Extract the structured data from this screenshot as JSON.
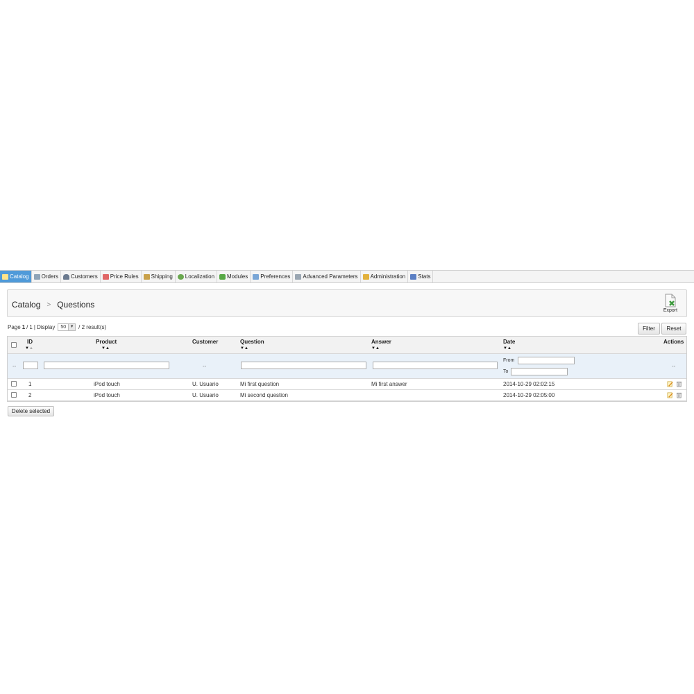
{
  "nav": {
    "tabs": [
      {
        "label": "Catalog",
        "icon": "folder-icon",
        "color": "#f2c94c",
        "active": true
      },
      {
        "label": "Orders",
        "icon": "cart-icon",
        "color": "#8fa4b8",
        "active": false
      },
      {
        "label": "Customers",
        "icon": "user-icon",
        "color": "#6b7a8f",
        "active": false
      },
      {
        "label": "Price Rules",
        "icon": "price-tag-icon",
        "color": "#e06666",
        "active": false
      },
      {
        "label": "Shipping",
        "icon": "truck-icon",
        "color": "#c9a14a",
        "active": false
      },
      {
        "label": "Localization",
        "icon": "globe-icon",
        "color": "#6aa84f",
        "active": false
      },
      {
        "label": "Modules",
        "icon": "puzzle-icon",
        "color": "#57a845",
        "active": false
      },
      {
        "label": "Preferences",
        "icon": "monitor-icon",
        "color": "#7aa6d6",
        "active": false
      },
      {
        "label": "Advanced Parameters",
        "icon": "wrench-icon",
        "color": "#9aa6b2",
        "active": false
      },
      {
        "label": "Administration",
        "icon": "key-icon",
        "color": "#e2b13c",
        "active": false
      },
      {
        "label": "Stats",
        "icon": "bar-chart-icon",
        "color": "#5b7fc4",
        "active": false
      }
    ]
  },
  "breadcrumb": {
    "parent": "Catalog",
    "separator": ">",
    "current": "Questions"
  },
  "toolbar": {
    "export_label": "Export",
    "export_icon": "export-icon"
  },
  "pager": {
    "page_prefix": "Page",
    "page_current": "1",
    "page_sep": "/",
    "page_total": "1",
    "display_label": "| Display",
    "per_page": "50",
    "results": "/ 2 result(s)"
  },
  "buttons": {
    "filter": "Filter",
    "reset": "Reset",
    "delete_selected": "Delete selected"
  },
  "table": {
    "columns": {
      "id": "ID",
      "product": "Product",
      "customer": "Customer",
      "question": "Question",
      "answer": "Answer",
      "date": "Date",
      "actions": "Actions"
    },
    "sort_glyph": "▼▲",
    "filters": {
      "dash": "--",
      "date_from_label": "From",
      "date_to_label": "To",
      "id_value": "",
      "product_value": "",
      "question_value": "",
      "answer_value": "",
      "date_from_value": "",
      "date_to_value": ""
    },
    "rows": [
      {
        "id": "1",
        "product": "iPod touch",
        "customer": "U. Usuario",
        "question": "Mi first question",
        "answer": "Mi first answer",
        "date": "2014-10-29 02:02:15"
      },
      {
        "id": "2",
        "product": "iPod touch",
        "customer": "U. Usuario",
        "question": "Mi second question",
        "answer": "",
        "date": "2014-10-29 02:05:00"
      }
    ],
    "row_actions": [
      {
        "icon": "edit-icon"
      },
      {
        "icon": "delete-icon"
      }
    ]
  }
}
